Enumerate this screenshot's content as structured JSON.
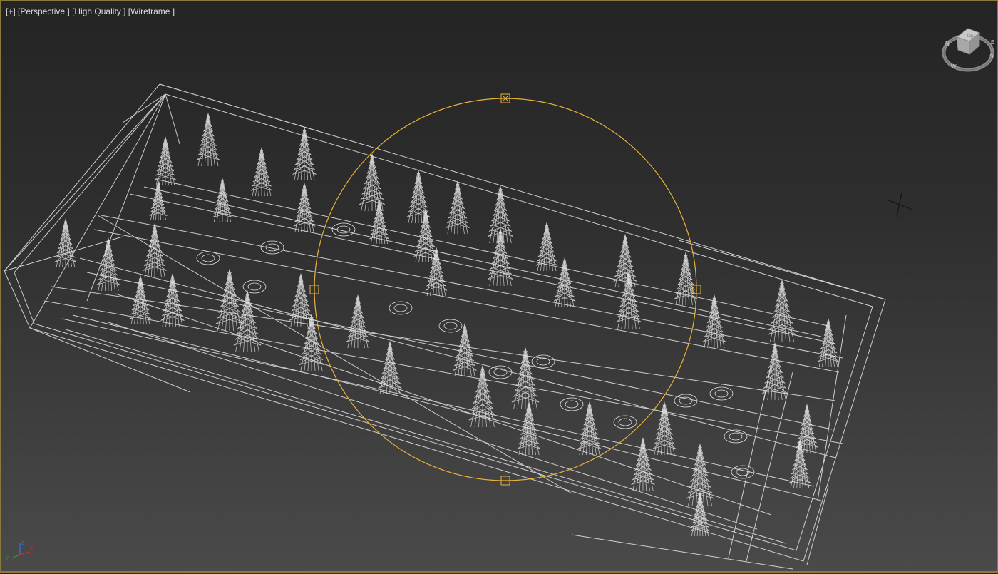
{
  "viewport": {
    "label_plus": "[+]",
    "label_view": "[Perspective ]",
    "label_quality": "[High Quality ]",
    "label_shading": "[Wireframe ]"
  },
  "colors": {
    "wire": "#dedede",
    "tree_wire": "#e6e6e6",
    "selection": "#e8b23a",
    "border": "#8a7a3a"
  },
  "viewcube": {
    "top_face": "top",
    "compass_letters": [
      "N",
      "W",
      "S",
      "E"
    ]
  },
  "axis_tripod": {
    "x": "x",
    "y": "y",
    "z": "z"
  },
  "icons": [
    "viewcube-icon",
    "axis-tripod-icon",
    "crosshair-icon",
    "selection-gizmo-icon"
  ]
}
